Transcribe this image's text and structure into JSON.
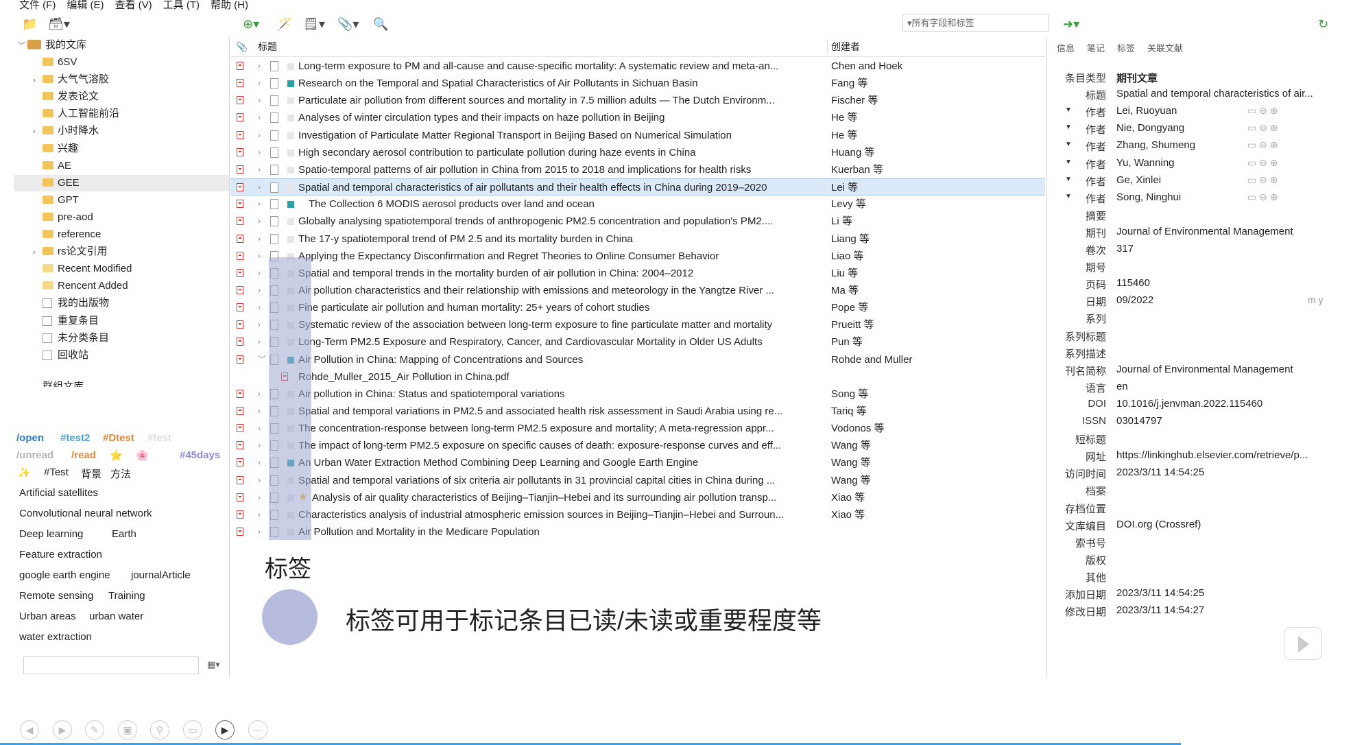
{
  "menu": [
    "文件 (F)",
    "编辑 (E)",
    "查看 (V)",
    "工具 (T)",
    "帮助 (H)"
  ],
  "search": {
    "placeholder": "▾所有字段和标签"
  },
  "library": {
    "root": "我的文库",
    "items": [
      {
        "label": "6SV",
        "expandable": false,
        "type": "folder"
      },
      {
        "label": "大气气溶胶",
        "expandable": true,
        "type": "folder"
      },
      {
        "label": "发表论文",
        "expandable": false,
        "type": "folder"
      },
      {
        "label": "人工智能前沿",
        "expandable": false,
        "type": "folder"
      },
      {
        "label": "小时降水",
        "expandable": true,
        "type": "folder"
      },
      {
        "label": "兴趣",
        "expandable": false,
        "type": "folder"
      },
      {
        "label": "AE",
        "expandable": false,
        "type": "folder"
      },
      {
        "label": "GEE",
        "expandable": false,
        "type": "folder"
      },
      {
        "label": "GPT",
        "expandable": false,
        "type": "folder"
      },
      {
        "label": "pre-aod",
        "expandable": false,
        "type": "folder"
      },
      {
        "label": "reference",
        "expandable": false,
        "type": "folder"
      },
      {
        "label": "rs论文引用",
        "expandable": true,
        "type": "folder"
      },
      {
        "label": "Recent Modified",
        "expandable": false,
        "type": "saved"
      },
      {
        "label": "Rencent Added",
        "expandable": false,
        "type": "saved"
      },
      {
        "label": "我的出版物",
        "expandable": false,
        "type": "special"
      },
      {
        "label": "重复条目",
        "expandable": false,
        "type": "special"
      },
      {
        "label": "未分类条目",
        "expandable": false,
        "type": "special"
      },
      {
        "label": "回收站",
        "expandable": false,
        "type": "special"
      }
    ],
    "partial": "群组文库"
  },
  "tags": {
    "colored": [
      {
        "label": "/open",
        "color": "#2e7bc4"
      },
      {
        "label": "#test2",
        "color": "#4aa0d8"
      },
      {
        "label": "#Dtest",
        "color": "#e7893b"
      },
      {
        "label": "#test",
        "color": "#dddddd"
      },
      {
        "label": "/unread",
        "color": "#b5b5b5"
      },
      {
        "label": "/read",
        "color": "#e7893b"
      },
      {
        "label": "#45days",
        "color": "#8f8bd6"
      }
    ],
    "emoji": [
      "⭐",
      "🌸",
      "✨"
    ],
    "plain": [
      "#Test",
      "背景",
      "方法",
      "Artificial satellites",
      "Convolutional neural network",
      "Deep learning",
      "Earth",
      "Feature extraction",
      "google earth engine",
      "journalArticle",
      "Remote sensing",
      "Training",
      "Urban areas",
      "urban water",
      "water extraction"
    ]
  },
  "columns": {
    "title": "标题",
    "creator": "创建者"
  },
  "items": [
    {
      "title": "Long-term exposure to PM and all-cause and cause-specific mortality: A systematic review and meta-an...",
      "creator": "Chen and Hoek",
      "color": ""
    },
    {
      "title": "Research on the Temporal and Spatial Characteristics of Air Pollutants in Sichuan Basin",
      "creator": "Fang 等",
      "color": "#2aa3a8"
    },
    {
      "title": "Particulate air pollution from different sources and mortality in 7.5 million adults — The Dutch Environm...",
      "creator": "Fischer 等",
      "color": ""
    },
    {
      "title": "Analyses of winter circulation types and their impacts on haze pollution in Beijing",
      "creator": "He 等",
      "color": ""
    },
    {
      "title": "Investigation of Particulate Matter Regional Transport in Beijing Based on Numerical Simulation",
      "creator": "He 等",
      "color": ""
    },
    {
      "title": "High secondary aerosol contribution to particulate pollution during haze events in China",
      "creator": "Huang 等",
      "color": ""
    },
    {
      "title": "Spatio-temporal patterns of air pollution in China from 2015 to 2018 and implications for health risks",
      "creator": "Kuerban 等",
      "color": ""
    },
    {
      "title": "Spatial and temporal characteristics of air pollutants and their health effects in China during 2019–2020",
      "creator": "Lei 等",
      "color": "",
      "selected": true
    },
    {
      "title": "The Collection 6 MODIS aerosol products over land and ocean",
      "creator": "Levy 等",
      "color": "#2aa3a8"
    },
    {
      "title": "Globally analysing spatiotemporal trends of anthropogenic PM2.5 concentration and population's PM2....",
      "creator": "Li 等",
      "color": ""
    },
    {
      "title": "The 17-y spatiotemporal trend of PM 2.5 and its mortality burden in China",
      "creator": "Liang 等",
      "color": ""
    },
    {
      "title": "Applying the Expectancy Disconfirmation and Regret Theories to Online Consumer Behavior",
      "creator": "Liao 等",
      "color": ""
    },
    {
      "title": "Spatial and temporal trends in the mortality burden of air pollution in China: 2004–2012",
      "creator": "Liu 等",
      "color": ""
    },
    {
      "title": "Air pollution characteristics and their relationship with emissions and meteorology in the Yangtze River ...",
      "creator": "Ma 等",
      "color": ""
    },
    {
      "title": "Fine particulate air pollution and human mortality: 25+ years of cohort studies",
      "creator": "Pope 等",
      "color": ""
    },
    {
      "title": "Systematic review of the association between long-term exposure to fine particulate matter and mortality",
      "creator": "Prueitt 等",
      "color": ""
    },
    {
      "title": "Long-Term PM2.5 Exposure and Respiratory, Cancer, and Cardiovascular Mortality in Older US Adults",
      "creator": "Pun 等",
      "color": ""
    },
    {
      "title": "Air Pollution in China: Mapping of Concentrations and Sources",
      "creator": "Rohde and Muller",
      "color": "#2aa3a8",
      "expanded": true
    },
    {
      "title": "Rohde_Muller_2015_Air Pollution in China.pdf",
      "creator": "",
      "color": "",
      "attachment": true
    },
    {
      "title": "Air pollution in China: Status and spatiotemporal variations",
      "creator": "Song 等",
      "color": ""
    },
    {
      "title": "Spatial and temporal variations in PM2.5 and associated health risk assessment in Saudi Arabia using re...",
      "creator": "Tariq 等",
      "color": ""
    },
    {
      "title": "The concentration-response between long-term PM2.5 exposure and mortality; A meta-regression appr...",
      "creator": "Vodonos 等",
      "color": ""
    },
    {
      "title": "The impact of long-term PM2.5 exposure on specific causes of death: exposure-response curves and eff...",
      "creator": "Wang 等",
      "color": ""
    },
    {
      "title": "An Urban Water Extraction Method Combining Deep Learning and Google Earth Engine",
      "creator": "Wang 等",
      "color": "#2aa3a8"
    },
    {
      "title": "Spatial and temporal variations of six criteria air pollutants in 31 provincial capital cities in China during ...",
      "creator": "Wang 等",
      "color": ""
    },
    {
      "title": "Analysis of air quality characteristics of Beijing–Tianjin–Hebei and its surrounding air pollution transp...",
      "creator": "Xiao 等",
      "color": "#f2b81a",
      "star": true
    },
    {
      "title": "Characteristics analysis of industrial atmospheric emission sources in Beijing–Tianjin–Hebei and Surroun...",
      "creator": "Xiao 等",
      "color": ""
    },
    {
      "title": "Air Pollution and Mortality in the Medicare Population",
      "creator": "",
      "color": ""
    }
  ],
  "overlay": {
    "heading": "标签",
    "caption": "标签可用于标记条目已读/未读或重要程度等"
  },
  "info_tabs": [
    "信息",
    "笔记",
    "标签",
    "关联文献"
  ],
  "info": [
    {
      "label": "条目类型",
      "value": "期刊文章",
      "bold": true
    },
    {
      "label": "标题",
      "value": "Spatial and temporal characteristics of air..."
    },
    {
      "label": "作者",
      "value": "Lei, Ruoyuan",
      "author": true
    },
    {
      "label": "作者",
      "value": "Nie, Dongyang",
      "author": true
    },
    {
      "label": "作者",
      "value": "Zhang, Shumeng",
      "author": true
    },
    {
      "label": "作者",
      "value": "Yu, Wanning",
      "author": true
    },
    {
      "label": "作者",
      "value": "Ge, Xinlei",
      "author": true
    },
    {
      "label": "作者",
      "value": "Song, Ninghui",
      "author": true
    },
    {
      "label": "摘要",
      "value": ""
    },
    {
      "label": "期刊",
      "value": "Journal of Environmental Management"
    },
    {
      "label": "卷次",
      "value": "317"
    },
    {
      "label": "期号",
      "value": ""
    },
    {
      "label": "页码",
      "value": "115460"
    },
    {
      "label": "日期",
      "value": "09/2022",
      "extra": "m y"
    },
    {
      "label": "系列",
      "value": ""
    },
    {
      "label": "系列标题",
      "value": ""
    },
    {
      "label": "系列描述",
      "value": ""
    },
    {
      "label": "刊名简称",
      "value": "Journal of Environmental Management"
    },
    {
      "label": "语言",
      "value": "en"
    },
    {
      "label": "DOI",
      "value": "10.1016/j.jenvman.2022.115460"
    },
    {
      "label": "ISSN",
      "value": "03014797"
    },
    {
      "label": "短标题",
      "value": ""
    },
    {
      "label": "网址",
      "value": "https://linkinghub.elsevier.com/retrieve/p..."
    },
    {
      "label": "访问时间",
      "value": "2023/3/11 14:54:25"
    },
    {
      "label": "档案",
      "value": ""
    },
    {
      "label": "存档位置",
      "value": ""
    },
    {
      "label": "文库编目",
      "value": "DOI.org (Crossref)"
    },
    {
      "label": "索书号",
      "value": ""
    },
    {
      "label": "版权",
      "value": ""
    },
    {
      "label": "其他",
      "value": ""
    },
    {
      "label": "添加日期",
      "value": "2023/3/11 14:54:25"
    },
    {
      "label": "修改日期",
      "value": "2023/3/11 14:54:27"
    }
  ],
  "colors": {
    "accent": "#3aa2e8",
    "selection": "#dbe9f8",
    "item_tag_teal": "#2aa3a8"
  }
}
